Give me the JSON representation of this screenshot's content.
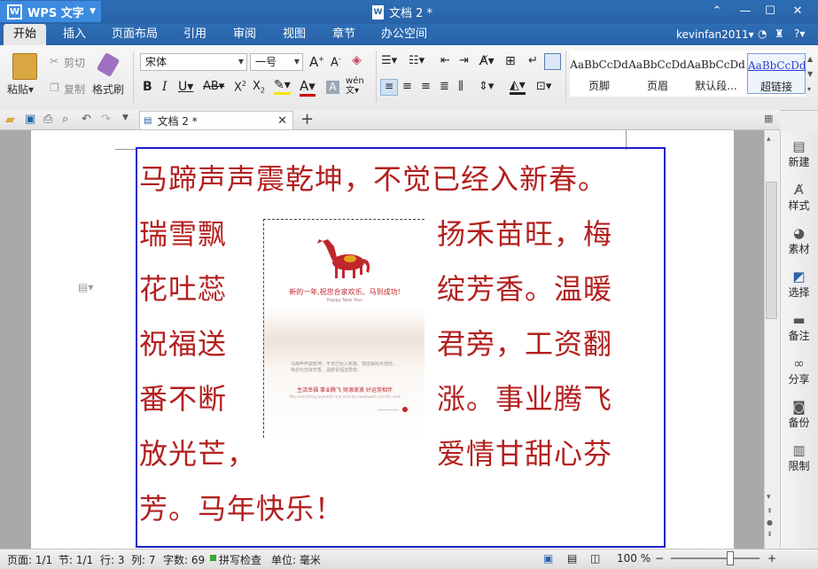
{
  "app": {
    "name": "WPS 文字",
    "logo_glyph": "W"
  },
  "window": {
    "title": "文档 2 *",
    "doc_icon": "W"
  },
  "menu_tabs": [
    "开始",
    "插入",
    "页面布局",
    "引用",
    "审阅",
    "视图",
    "章节",
    "办公空间"
  ],
  "active_tab": "开始",
  "user": {
    "name": "kevinfan2011▾"
  },
  "ribbon": {
    "paste": "粘贴▾",
    "cut": "剪切",
    "copy": "复制",
    "format_painter": "格式刷",
    "font_name": "宋体",
    "font_size": "一号",
    "styles": [
      {
        "sample": "AaBbCcDd",
        "label": "页脚"
      },
      {
        "sample": "AaBbCcDd",
        "label": "页眉"
      },
      {
        "sample": "AaBbCcDd",
        "label": "默认段..."
      },
      {
        "sample": "AaBbCcDd",
        "label": "超链接"
      }
    ]
  },
  "doc_tab": {
    "label": "文档 2 *"
  },
  "document": {
    "lines": [
      "马蹄声声震乾坤，不觉已经入新春。",
      "瑞雪飘",
      "扬禾苗旺，梅",
      "花吐蕊",
      "绽芳香。温暖",
      "祝福送",
      "君旁，工资翻",
      "番不断",
      "涨。事业腾飞",
      "放光芒，",
      "爱情甘甜心芬",
      "芳。马年快乐！"
    ],
    "figure": {
      "headline": "新的一年,祝您合家欢乐、马到成功!",
      "subline": "Happy New Year",
      "body": "马蹄声声震乾坤，不觉已经入新春。瑞雪飘扬禾苗旺，梅花吐蕊绽芳香。温暖祝福送君旁。",
      "slogan": "生活幸福 事业腾飞 财源滚滚 好运常相伴",
      "english": "May everything beautiful and hard be swallowed into this card"
    }
  },
  "sidebar": [
    "新建",
    "样式",
    "素材",
    "选择",
    "备注",
    "分享",
    "备份",
    "限制"
  ],
  "status": {
    "page": "页面: 1/1",
    "section": "节: 1/1",
    "row": "行: 3",
    "col": "列: 7",
    "words": "字数: 69",
    "spell": "拼写检查",
    "unit": "单位: 毫米",
    "zoom": "100 %"
  },
  "colors": {
    "accent": "#2a63a8",
    "text_red": "#b3201f",
    "selection": "#1c1ccc"
  }
}
